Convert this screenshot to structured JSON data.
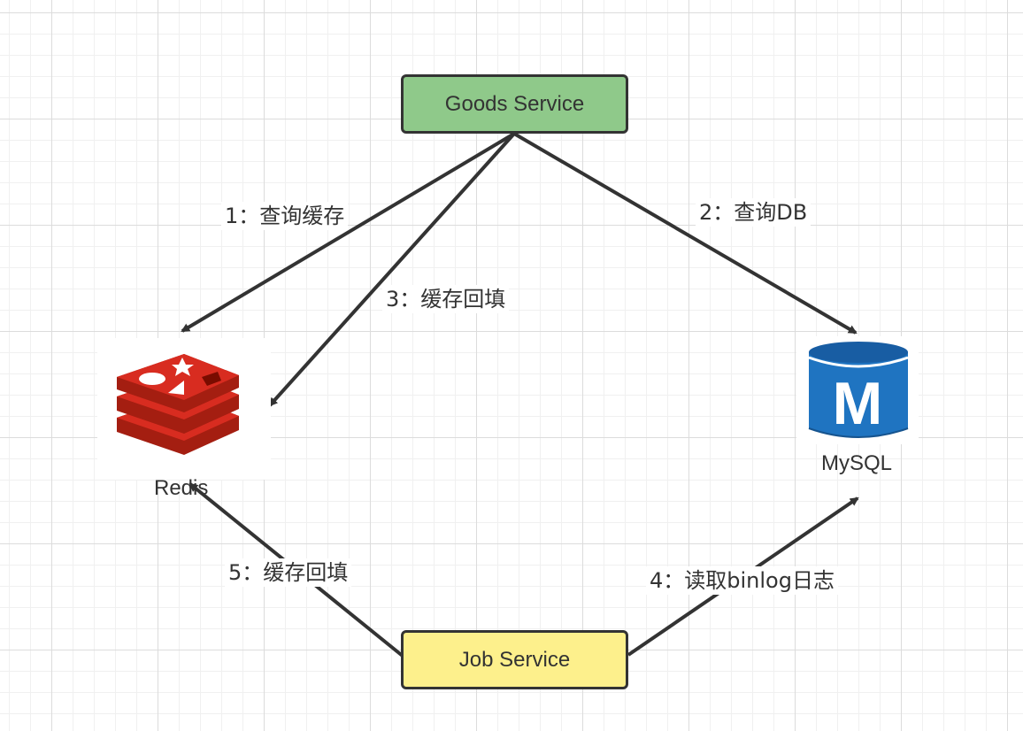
{
  "nodes": {
    "goods_service": "Goods Service",
    "job_service": "Job Service",
    "redis": "Redis",
    "mysql": "MySQL"
  },
  "edges": {
    "query_cache": "1：查询缓存",
    "query_db": "2：查询DB",
    "cache_fill_goods": "3：缓存回填",
    "read_binlog": "4：读取binlog日志",
    "cache_fill_job": "5：缓存回填"
  },
  "icons": {
    "redis": "redis-logo-icon",
    "mysql": "mysql-database-icon",
    "mysql_letter": "M"
  },
  "colors": {
    "goods_fill": "#8fc98a",
    "job_fill": "#fdf08c",
    "stroke": "#333333",
    "redis_red": "#c6302b",
    "mysql_blue": "#1f74c1"
  }
}
